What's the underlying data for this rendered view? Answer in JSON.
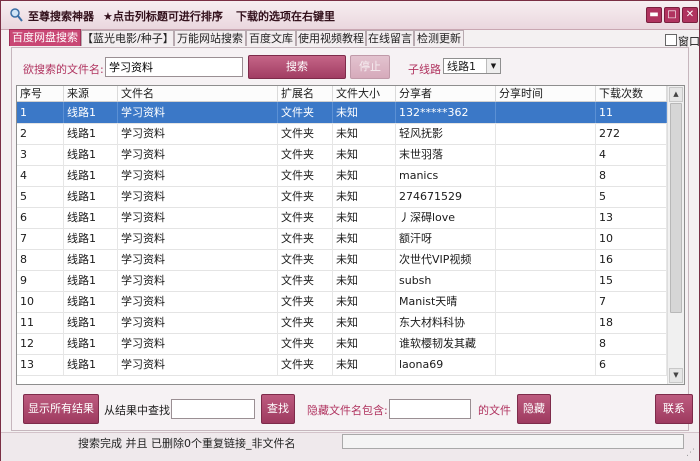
{
  "window": {
    "app_title": "至尊搜索神器",
    "hint_sort": "★点击列标题可进行排序",
    "hint_options": "下载的选项在右键里",
    "controls": {
      "minimize": "▬",
      "maximize": "□",
      "close": "✕"
    }
  },
  "tabs": [
    {
      "label": "百度网盘搜索"
    },
    {
      "label": "【蓝光电影/种子】"
    },
    {
      "label": "万能网站搜索"
    },
    {
      "label": "百度文库"
    },
    {
      "label": "使用视频教程"
    },
    {
      "label": "在线留言"
    },
    {
      "label": "检测更新"
    }
  ],
  "window_check_label": "窗口",
  "search": {
    "label": "欲搜索的文件名:",
    "value": "学习资料",
    "button": "搜索",
    "stop_button": "停止",
    "sub_label": "子线路",
    "sub_value": "线路1"
  },
  "table": {
    "columns": [
      "序号",
      "来源",
      "文件名",
      "扩展名",
      "文件大小",
      "分享者",
      "分享时间",
      "下载次数"
    ],
    "rows": [
      [
        "1",
        "线路1",
        "学习资料",
        "文件夹",
        "未知",
        "132*****362",
        "",
        "11"
      ],
      [
        "2",
        "线路1",
        "学习资料",
        "文件夹",
        "未知",
        "轻风抚影",
        "",
        "272"
      ],
      [
        "3",
        "线路1",
        "学习资料",
        "文件夹",
        "未知",
        "末世羽落",
        "",
        "4"
      ],
      [
        "4",
        "线路1",
        "学习资料",
        "文件夹",
        "未知",
        "manics",
        "",
        "8"
      ],
      [
        "5",
        "线路1",
        "学习资料",
        "文件夹",
        "未知",
        "274671529",
        "",
        "5"
      ],
      [
        "6",
        "线路1",
        "学习资料",
        "文件夹",
        "未知",
        "丿深碍love",
        "",
        "13"
      ],
      [
        "7",
        "线路1",
        "学习资料",
        "文件夹",
        "未知",
        "额汗呀",
        "",
        "10"
      ],
      [
        "8",
        "线路1",
        "学习资料",
        "文件夹",
        "未知",
        "次世代VIP视频",
        "",
        "16"
      ],
      [
        "9",
        "线路1",
        "学习资料",
        "文件夹",
        "未知",
        "subsh",
        "",
        "15"
      ],
      [
        "10",
        "线路1",
        "学习资料",
        "文件夹",
        "未知",
        "Manist天晴",
        "",
        "7"
      ],
      [
        "11",
        "线路1",
        "学习资料",
        "文件夹",
        "未知",
        "东大材料科协",
        "",
        "18"
      ],
      [
        "12",
        "线路1",
        "学习资料",
        "文件夹",
        "未知",
        "谁软樱韧发其藏",
        "",
        "8"
      ],
      [
        "13",
        "线路1",
        "学习资料",
        "文件夹",
        "未知",
        "laona69",
        "",
        "6"
      ]
    ],
    "selected_row": 0
  },
  "bottom": {
    "show_all": "显示所有结果",
    "find_label": "从结果中查找:",
    "find_button": "查找",
    "hide_label": "隐藏文件名包含:",
    "hide_suffix": "的文件",
    "hide_button": "隐藏",
    "contact_button": "联系"
  },
  "status": {
    "text": "搜索完成 并且 已删除0个重复链接_非文件名"
  },
  "colors": {
    "accent": "#b0335f",
    "selection": "#3b78c7",
    "frame": "#a8516b"
  }
}
